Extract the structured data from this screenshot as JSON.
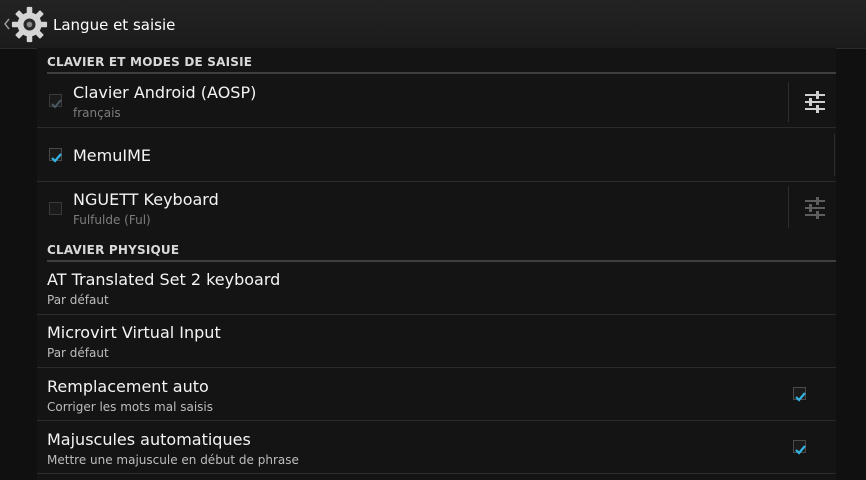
{
  "actionbar": {
    "title": "Langue et saisie",
    "up_icon": "chevron-left-icon",
    "app_icon": "gear-icon"
  },
  "sections": {
    "keyboards_header": "CLAVIER ET MODES DE SAISIE",
    "physical_header": "CLAVIER PHYSIQUE"
  },
  "ime": [
    {
      "title": "Clavier Android (AOSP)",
      "subtitle": "français",
      "checked": true,
      "enabled": false,
      "has_settings": true
    },
    {
      "title": "MemuIME",
      "subtitle": "",
      "checked": true,
      "enabled": true,
      "has_settings": false
    },
    {
      "title": "NGUETT Keyboard",
      "subtitle": "Fulfulde (Ful)",
      "checked": false,
      "enabled": false,
      "has_settings": true
    }
  ],
  "physical": [
    {
      "title": "AT Translated Set 2 keyboard",
      "subtitle": "Par défaut"
    },
    {
      "title": "Microvirt Virtual Input",
      "subtitle": "Par défaut"
    }
  ],
  "prefs": [
    {
      "title": "Remplacement auto",
      "subtitle": "Corriger les mots mal saisis",
      "checked": true
    },
    {
      "title": "Majuscules automatiques",
      "subtitle": "Mettre une majuscule en début de phrase",
      "checked": true
    }
  ],
  "colors": {
    "accent": "#33b5e5",
    "background": "#101010"
  }
}
